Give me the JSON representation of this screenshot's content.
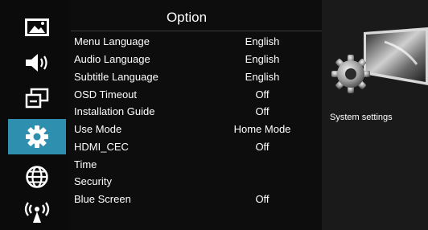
{
  "panel": {
    "title": "Option"
  },
  "sidebar": {
    "items": [
      {
        "icon": "picture-icon"
      },
      {
        "icon": "sound-icon"
      },
      {
        "icon": "channel-source-icon"
      },
      {
        "icon": "gear-icon",
        "active": true
      },
      {
        "icon": "globe-icon"
      },
      {
        "icon": "antenna-icon"
      }
    ]
  },
  "menu": {
    "items": [
      {
        "label": "Menu Language",
        "value": "English"
      },
      {
        "label": "Audio Language",
        "value": "English"
      },
      {
        "label": "Subtitle Language",
        "value": "English"
      },
      {
        "label": "OSD Timeout",
        "value": "Off"
      },
      {
        "label": "Installation Guide",
        "value": "Off"
      },
      {
        "label": "Use Mode",
        "value": "Home Mode"
      },
      {
        "label": "HDMI_CEC",
        "value": "Off"
      },
      {
        "label": "Time",
        "value": ""
      },
      {
        "label": "Security",
        "value": ""
      },
      {
        "label": "Blue Screen",
        "value": "Off"
      }
    ]
  },
  "info": {
    "caption": "System settings"
  },
  "colors": {
    "accent": "#2e8fae",
    "panel": "#0d0d0d",
    "info_bg": "#1a1a1a"
  }
}
